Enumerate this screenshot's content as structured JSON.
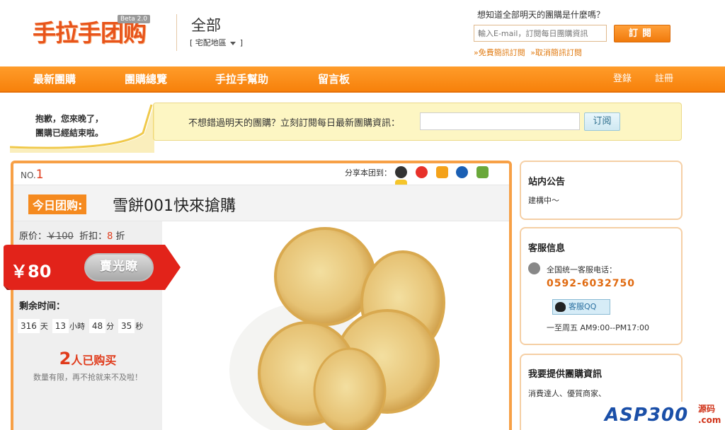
{
  "header": {
    "logo_text": "手拉手团购",
    "logo_beta": "Beta 2.0",
    "city_name": "全部",
    "city_switch": "宅配地區",
    "subscribe_question": "想知道全部明天的團購是什麼嗎？",
    "subscribe_placeholder": "輸入E-mail，訂閱每日團購資訊",
    "subscribe_button": "訂閱",
    "link_free": "»免費簡訊訂閱",
    "link_cancel": "»取消簡訊訂閱"
  },
  "nav": {
    "items": [
      "最新團購",
      "團購總覽",
      "手拉手幫助",
      "留言板"
    ],
    "login": "登錄",
    "register": "註冊"
  },
  "notice": {
    "sorry_line1": "抱歉，您來晚了，",
    "sorry_line2": "團購已經結束啦。",
    "prompt": "不想錯過明天的團購？立刻訂閱每日最新團購資訊：",
    "button": "订阅"
  },
  "deal": {
    "no_label": "NO.",
    "no_value": "1",
    "share_label": "分享本团到：",
    "today_tag": "今日团购:",
    "title": "雪餅001快來搶購",
    "original_price_label": "原价：",
    "original_price": "￥100",
    "discount_label": "折扣：",
    "discount_value": "8",
    "discount_unit": "折",
    "price": "￥80",
    "sold_out": "賣光瞭",
    "remain_label": "剩余时间：",
    "timer": {
      "days": "316",
      "days_unit": "天",
      "hours": "13",
      "hours_unit": "小時",
      "minutes": "48",
      "minutes_unit": "分",
      "seconds": "35",
      "seconds_unit": "秒"
    },
    "bought_count": "2",
    "bought_suffix": "人已购买",
    "limited": "数量有限，再不抢就来不及啦！"
  },
  "sidebar": {
    "announce_title": "站内公告",
    "announce_text": "建構中～",
    "service_title": "客服信息",
    "service_phone_label": "全国统一客服电话：",
    "service_phone": "0592-6032750",
    "qq_label": "客服QQ",
    "service_hours": "一至周五 AM9:00--PM17:00",
    "provide_title": "我要提供團購資訊",
    "provide_text": "消費達人、優質商家、"
  },
  "watermark": {
    "text": "ASP300",
    "side1": "源码",
    "side2": ".com"
  },
  "colors": {
    "brand_orange": "#f7810b",
    "price_red": "#e03a1a",
    "notice_yellow": "#fdf6c3"
  }
}
